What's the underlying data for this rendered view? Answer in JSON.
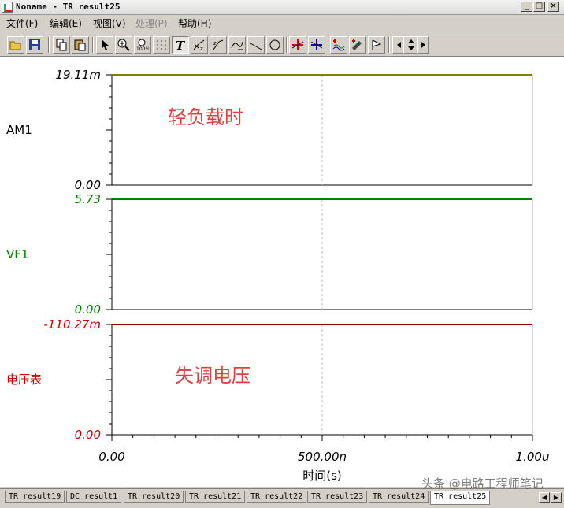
{
  "window": {
    "title": "Noname - TR result25",
    "buttons": [
      "_",
      "□",
      "×"
    ]
  },
  "menu": [
    {
      "label": "文件(F)",
      "enabled": true
    },
    {
      "label": "编辑(E)",
      "enabled": true
    },
    {
      "label": "视图(V)",
      "enabled": true
    },
    {
      "label": "处理(P)",
      "enabled": false
    },
    {
      "label": "帮助(H)",
      "enabled": true
    }
  ],
  "toolbar": {
    "icons": [
      "open-icon",
      "save-icon",
      "copy-icon",
      "paste-icon",
      "pointer-icon",
      "zoom-in-icon",
      "zoom-100-icon",
      "grid-icon",
      "text-tool-icon",
      "cursor-tool-icon",
      "cursor2-tool-icon",
      "curve-tool-icon",
      "line-icon",
      "ellipse-icon",
      "cursor-a-icon",
      "cursor-b-icon",
      "waveform-icon",
      "probe-icon",
      "flag-icon",
      "arrow-left-icon",
      "arrow-updown-icon",
      "arrow-right-icon"
    ]
  },
  "chart_data": {
    "type": "line",
    "xlabel": "时间(s)",
    "x_ticks": [
      "0.00",
      "500.00n",
      "1.00u"
    ],
    "xlim": [
      0,
      1e-06
    ],
    "panels": [
      {
        "name": "AM1",
        "color": "#808000",
        "label_color": "#000000",
        "top_label": "19.11m",
        "bottom_label": "0.00",
        "ylim": [
          0,
          0.01911
        ],
        "series": {
          "x": [
            0,
            1e-06
          ],
          "y": [
            0.01911,
            0.01911
          ]
        },
        "annotation": "轻负载时"
      },
      {
        "name": "VF1",
        "color": "#008000",
        "label_color": "#008000",
        "top_label": "5.73",
        "bottom_label": "0.00",
        "ylim": [
          0,
          5.73
        ],
        "series": {
          "x": [
            0,
            1e-06
          ],
          "y": [
            5.73,
            5.73
          ]
        },
        "annotation": ""
      },
      {
        "name": "电压表",
        "color": "#8b0000",
        "label_color": "#cc0000",
        "top_label": "-110.27m",
        "bottom_label": "0.00",
        "ylim": [
          0,
          -0.11027
        ],
        "series": {
          "x": [
            0,
            1e-06
          ],
          "y": [
            -0.11027,
            -0.11027
          ]
        },
        "annotation": "失调电压"
      }
    ],
    "grid": true
  },
  "tabs": [
    {
      "label": "TR result19",
      "active": false
    },
    {
      "label": "DC result1",
      "active": false
    },
    {
      "label": "TR result20",
      "active": false
    },
    {
      "label": "TR result21",
      "active": false
    },
    {
      "label": "TR result22",
      "active": false
    },
    {
      "label": "TR result23",
      "active": false
    },
    {
      "label": "TR result24",
      "active": false
    },
    {
      "label": "TR result25",
      "active": true
    }
  ],
  "watermark": "头条 @电路工程师笔记"
}
